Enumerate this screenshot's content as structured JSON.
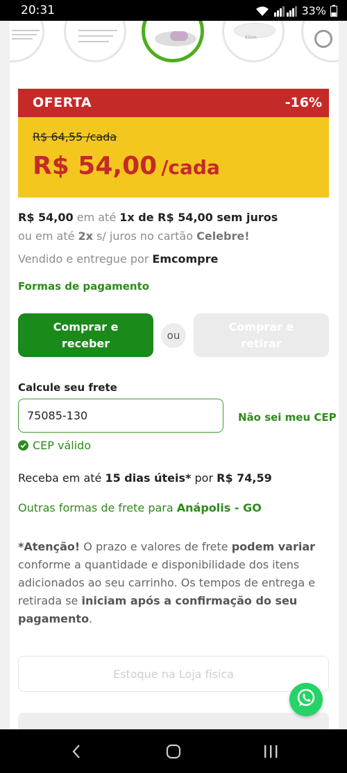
{
  "status_bar": {
    "time": "20:31",
    "battery": "33%",
    "icons": [
      "wifi-icon",
      "signal-icon",
      "battery-icon"
    ]
  },
  "thumbnails": {
    "captions": [
      "65cm"
    ],
    "active_index": 2
  },
  "offer": {
    "label": "OFERTA",
    "discount": "-16%",
    "old_price": "R$ 64,55 /cada",
    "price": "R$ 54,00",
    "unit": "/cada"
  },
  "installments": {
    "price": "R$ 54,00",
    "connector": "em até",
    "plan": "1x de R$ 54,00 sem juros"
  },
  "card_offer": {
    "prefix": "ou em até",
    "count": "2x",
    "middle": "s/ juros no cartão",
    "card": "Celebre!"
  },
  "seller": {
    "prefix": "Vendido e entregue por",
    "name": "Emcompre"
  },
  "payment_link": "Formas de pagamento",
  "buttons": {
    "buy_receive": "Comprar e receber",
    "or": "ou",
    "buy_pickup": "Comprar e retirar"
  },
  "freight": {
    "title": "Calcule seu frete",
    "cep_value": "75085-130",
    "unknown_cep": "Não sei meu CEP",
    "valid": "CEP válido",
    "delivery_prefix": "Receba em até",
    "delivery_days": "15 dias úteis*",
    "delivery_mid": "por",
    "delivery_price": "R$ 74,59",
    "other_prefix": "Outras formas de frete para",
    "other_city": "Anápolis - GO"
  },
  "notice": {
    "p1": "*Atenção!",
    "p2": " O prazo e valores de frete ",
    "p3": "podem variar",
    "p4": " conforme a quantidade e disponibilidade dos itens adicionados ao seu carrinho. Os tempos de entrega e retirada se ",
    "p5": "iniciam após a confirmação do seu pagamento",
    "p6": "."
  },
  "stock_button": "Estoque na Loja física",
  "colors": {
    "offer_red": "#c42a27",
    "offer_yellow": "#f4c71f",
    "brand_green": "#1a8a1b",
    "link_green": "#2e8b1b",
    "whatsapp": "#25d366"
  }
}
